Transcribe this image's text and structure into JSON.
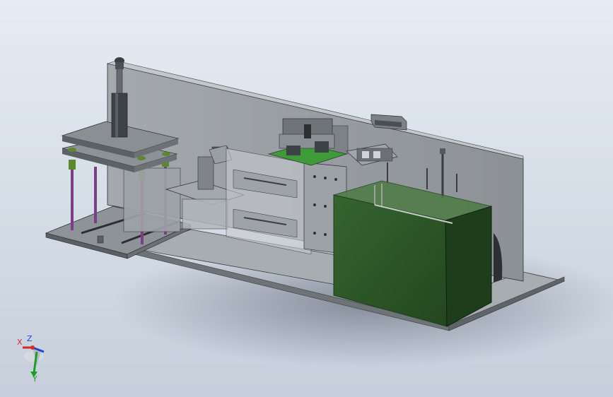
{
  "viewport": {
    "background_top": "#e6ecf3",
    "background_bottom": "#c6cfdb"
  },
  "colors": {
    "steel": "#8f959b",
    "steel_dark": "#5b6066",
    "steel_light": "#b7bcc2",
    "enclosure_green": "#2f5a2a",
    "enclosure_green_dark": "#1e3d1a",
    "pcb_green": "#3f9a3a",
    "rod_purple": "#7b3f86",
    "spring_green": "#5a8a2a"
  },
  "triad": {
    "x_label": "X",
    "y_label": "Y",
    "z_label": "Z",
    "x_color": "#d42a2a",
    "y_color": "#1f9b2a",
    "z_color": "#1f45d4"
  }
}
